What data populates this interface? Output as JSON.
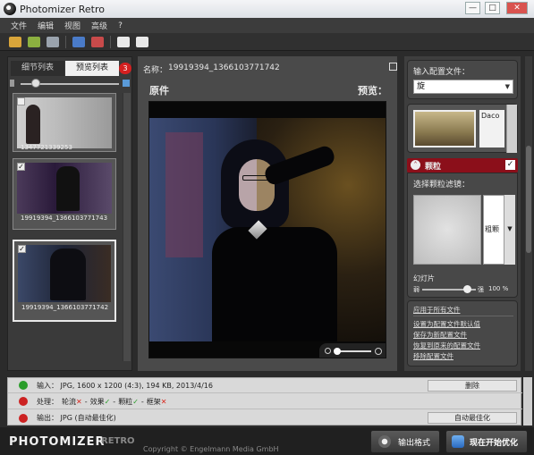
{
  "window": {
    "title": "Photomizer Retro",
    "controls": [
      "—",
      "□",
      "✕"
    ]
  },
  "menu": {
    "items": [
      "文件",
      "编辑",
      "视图",
      "高级",
      "?"
    ]
  },
  "left": {
    "tabs": [
      "细节列表",
      "预览列表"
    ],
    "badge": "3",
    "thumbnails": [
      {
        "caption": "1347721339253",
        "checked": false
      },
      {
        "caption": "19919394_1366103771743",
        "checked": true
      },
      {
        "caption": "19919394_1366103771742",
        "checked": true
      }
    ]
  },
  "center": {
    "name_label": "名称：",
    "name_value": "19919394_1366103771742",
    "original_label": "原件",
    "preview_label": "预览："
  },
  "right": {
    "input_config_label": "输入配置文件：",
    "input_config_value": "旋",
    "effect_name": "Daco",
    "grain_title": "颗粒",
    "grain_filter_label": "选择颗粒滤镜：",
    "grain_filter_value": "粗颗",
    "slide_label": "幻灯片",
    "slide_weak": "弱",
    "slide_strong": "强",
    "slide_value": "100 %",
    "slide_level": 1.0,
    "links": [
      "应用于所有文件",
      "设置为配置文件默认值",
      "保存为新配置文件",
      "恢复到原来的配置文件",
      "移除配置文件"
    ]
  },
  "status": {
    "input_text": "输入：  JPG, 1600 x 1200 (4:3), 194 KB, 2013/4/16",
    "input_btn": "删除",
    "process_label": "处理：",
    "process_items": [
      "轮流",
      "效果",
      "颗粒",
      "框架"
    ],
    "process_marks": [
      "✕",
      "✓",
      "✓",
      "✕"
    ],
    "output_text": "输出：  JPG (自动最佳化)",
    "output_btn": "自动最佳化"
  },
  "footer": {
    "brand_main": "PHOTOMIZER",
    "brand_sub": "RETRO",
    "copyright": "Copyright © Engelmann Media GmbH",
    "export_btn": "输出格式",
    "start_btn": "现在开始优化"
  },
  "colors": {
    "accent_red": "#8b0f1a",
    "badge_red": "#d42020",
    "check_red": "#d9261c",
    "check_green": "#2a9d2a"
  }
}
